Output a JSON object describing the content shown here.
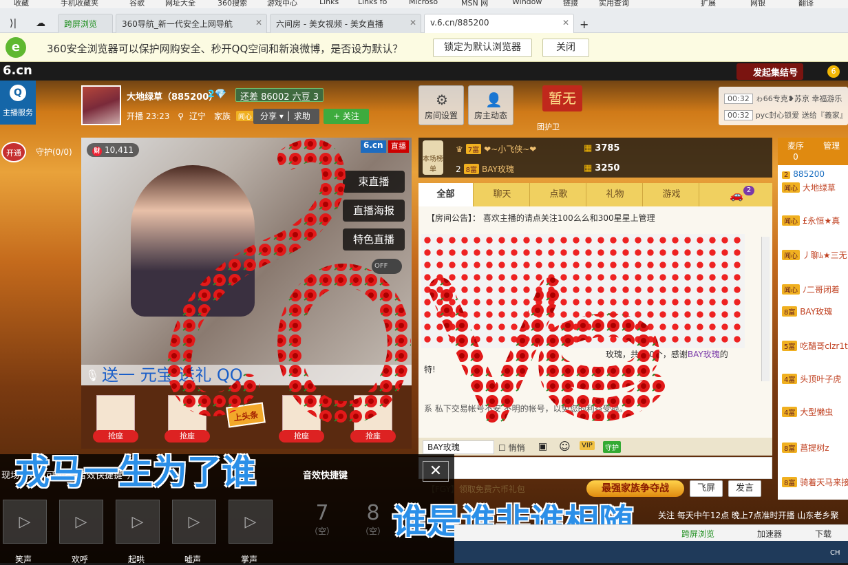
{
  "bookmarks": [
    "收藏",
    "手机收藏夹",
    "谷歌",
    "网址大全",
    "360搜索",
    "游戏中心",
    "Links",
    "Links fo",
    "Microso",
    "MSN 网",
    "Window",
    "链接",
    "实用查询",
    "扩展",
    "网银",
    "翻译"
  ],
  "tabs": [
    {
      "label": "跨屏浏览"
    },
    {
      "label": "360导航_新一代安全上网导航"
    },
    {
      "label": "六间房 - 美女视频 - 美女直播"
    },
    {
      "label": "v.6.cn/885200"
    }
  ],
  "infobar": {
    "message": "360安全浏览器可以保护网购安全、秒开QQ空间和新浪微博，是否设为默认？",
    "lock_button": "锁定为默认浏览器",
    "close_button": "关闭"
  },
  "site": {
    "logo": "6.cn",
    "guild_label": "发起集结号",
    "service_label": "主播服务"
  },
  "host": {
    "name": "大地绿草（885200）",
    "level": "2",
    "short_text": "还差 86002 六豆 3",
    "time": "开播 23:23",
    "location": "辽宁",
    "family_label": "家族",
    "family_tag": "闻心",
    "share_label": "分享 ▾ │ 求助",
    "follow_label": "+ 关注"
  },
  "room_buttons": {
    "settings": "房间设置",
    "activity": "房主动态"
  },
  "zanwu": "暂无",
  "guard_badge": "团护卫",
  "notices": [
    {
      "time": "00:32",
      "text": "ゎ66专克❥苏京 幸福游乐"
    },
    {
      "time": "00:32",
      "text": "pyc封心锁爱 送给『義家』"
    }
  ],
  "guard": {
    "open_label": "开通",
    "count_label": "守护(0/0)"
  },
  "video": {
    "viewers": "10,411",
    "brand": "6.cn",
    "live": "直播",
    "buttons": [
      "束直播",
      "直播海报",
      "特色直播"
    ],
    "toggle": "OFF",
    "ticker": "送一  元宝        送礼  QQ"
  },
  "seats": {
    "grab_label": "抢座",
    "toutiao": "上头条"
  },
  "rank": {
    "badge": "本场榜单",
    "rows": [
      {
        "idx": "",
        "level": "7富",
        "name": "❤~小飞侠~❤",
        "value": "3785"
      },
      {
        "idx": "2",
        "level": "8富",
        "name": "BAY玫瑰",
        "value": "3250"
      }
    ]
  },
  "chat_tabs": [
    "全部",
    "聊天",
    "点歌",
    "礼物",
    "游戏"
  ],
  "car_count": "2",
  "announcement": "【房间公告】：  喜欢主播的请点关注100么么和300星星上管理",
  "chat_msg1": "玫瑰，共300个，感谢",
  "chat_msg1_user": "BAY玫瑰",
  "chat_msg1_tail": "的",
  "chat_msg2": "特!",
  "safety": "系        私下交易帐号不安                  不明的帐号，以免您的利益受损。",
  "input": {
    "target": "BAY玫瑰",
    "quiet": "悄悄",
    "link_free": "【FGY】领取免费六币礼包",
    "battle": "最强家族争夺战",
    "fly": "飞屏",
    "send": "发言"
  },
  "right_head": [
    {
      "label": "麦序",
      "count": "0"
    },
    {
      "label": "管理",
      "count": ""
    }
  ],
  "right_list": [
    {
      "badge": "2",
      "name": "885200"
    },
    {
      "badge": "闻心",
      "name": "大地绿草"
    },
    {
      "badge": "闻心",
      "name": "£永恒★真"
    },
    {
      "badge": "闻心",
      "name": "丿聊ﾑ★三无"
    },
    {
      "badge": "闻心",
      "name": "ﾉ二哥闭着"
    },
    {
      "badge": "8富",
      "name": "BAY玫瑰"
    },
    {
      "badge": "5富",
      "name": "吃醋哥clzr1t"
    },
    {
      "badge": "4富",
      "name": "头顶叶子虎"
    },
    {
      "badge": "4富",
      "name": "大型懒虫"
    },
    {
      "badge": "8富",
      "name": "菖提树z"
    },
    {
      "badge": "8富",
      "name": "骑着天马来接你"
    }
  ],
  "bottom": {
    "title": "现场音效（可配置“音效快捷键”）",
    "sfx_title": "音效快捷键",
    "sfx_labels": [
      "笑声",
      "欢呼",
      "起哄",
      "嘘声",
      "掌声"
    ],
    "nums": [
      {
        "n": "7",
        "label": "（空）"
      },
      {
        "n": "8",
        "label": "（空）"
      }
    ]
  },
  "lyrics": {
    "line1": "戎马一生为了谁",
    "line2": "谁是谁非谁相随"
  },
  "bottom_ticker": "关注 每天中午12点 晚上7点准时开播 山东老乡聚",
  "statusbar": [
    "跨屏浏览",
    "加速器",
    "下载"
  ],
  "ime": "CH",
  "colors": {
    "accent": "#e08a10",
    "love": "#e21a1a",
    "lyric": "#2b8fe8"
  }
}
